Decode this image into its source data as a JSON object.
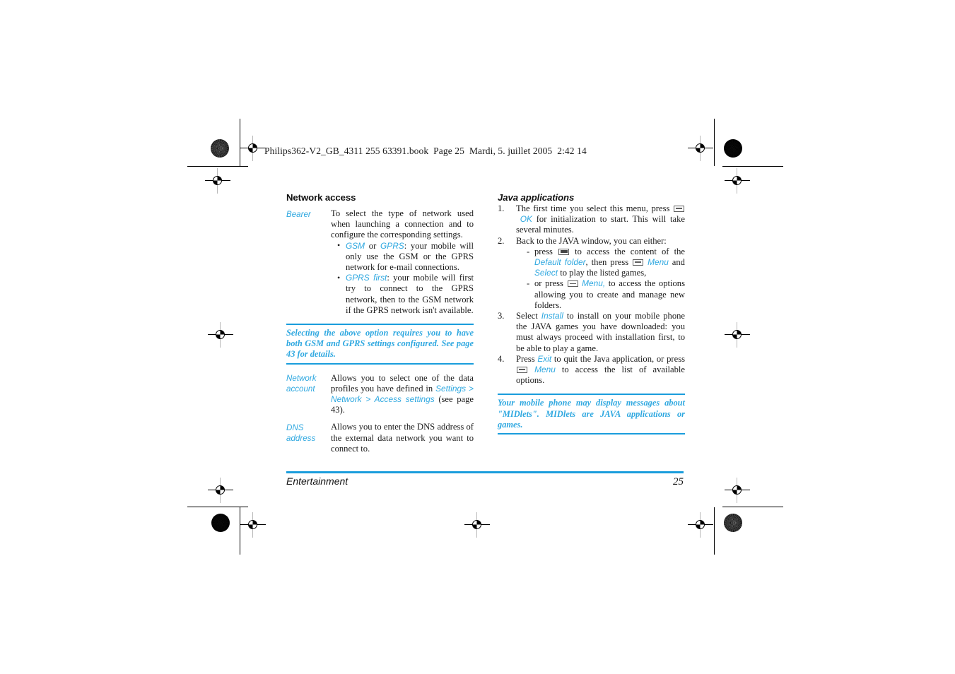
{
  "print_slug": "Philips362-V2_GB_4311 255 63391.book  Page 25  Mardi, 5. juillet 2005  2:42 14",
  "footer": {
    "chapter": "Entertainment",
    "page_number": "25"
  },
  "colors": {
    "accent_blue": "#2fa8e0",
    "rule_blue": "#1a9ddc",
    "body_text": "#1a1a1a"
  },
  "left_column": {
    "heading": "Network access",
    "entries": [
      {
        "term": "Bearer",
        "intro": "To select the type of network used when launching a connection and to configure the corresponding settings.",
        "bullets": [
          {
            "keyword_a": "GSM",
            "joiner": " or ",
            "keyword_b": "GPRS",
            "text": ": your mobile will only use the GSM or the GPRS network for e-mail connections."
          },
          {
            "keyword_a": "GPRS first",
            "text": ": your mobile will first try to connect to the GPRS network, then to the GSM network if the GPRS network isn't available."
          }
        ]
      }
    ],
    "note": "Selecting the above option requires you to have both GSM and GPRS settings configured. See page 43 for details.",
    "entries_after_note": [
      {
        "term": "Network account",
        "text_1": "Allows you to select one of the data profiles you have defined in ",
        "kw_1": "Settings",
        "sep_1": " > ",
        "kw_2": "Network",
        "sep_2": " > ",
        "kw_3": "Access settings",
        "text_2": " (see page 43)."
      },
      {
        "term": "DNS address",
        "text_1": "Allows you to enter the DNS address of the external data network you want to connect to."
      }
    ]
  },
  "right_column": {
    "heading": "Java applications",
    "steps": [
      {
        "num": "1.",
        "part_1": "The first time you select this menu, press ",
        "icon_1": "softkey-icon",
        "kw_1": "OK",
        "part_2": " for initialization to start. This will take several minutes."
      },
      {
        "num": "2.",
        "part_1": "Back to the JAVA window, you can either:",
        "sub_items": [
          {
            "part_1": "press ",
            "icon_1": "centerkey-icon",
            "part_2": " to access the content of the ",
            "kw_1": "Default folder",
            "part_3": ", then press ",
            "icon_2": "softkey-icon",
            "kw_2": "Menu",
            "part_4": " and ",
            "kw_3": "Select",
            "part_5": " to play the listed games,"
          },
          {
            "part_1": "or press ",
            "icon_1": "softkey-icon",
            "kw_1": "Menu,",
            "part_2": " to access the options allowing you to create and manage new folders."
          }
        ]
      },
      {
        "num": "3.",
        "part_1": "Select ",
        "kw_1": "Install",
        "part_2": " to install on your mobile phone the JAVA games you have downloaded: you must always proceed with installation first, to be able to play a game."
      },
      {
        "num": "4.",
        "part_1": "Press ",
        "kw_1": "Exit",
        "part_2": " to quit the Java application, or press ",
        "icon_1": "softkey-icon",
        "kw_2": "Menu",
        "part_3": " to access the list of available options."
      }
    ],
    "note": "Your mobile phone may display messages about \"MIDlets\". MIDlets are JAVA applications or games."
  }
}
